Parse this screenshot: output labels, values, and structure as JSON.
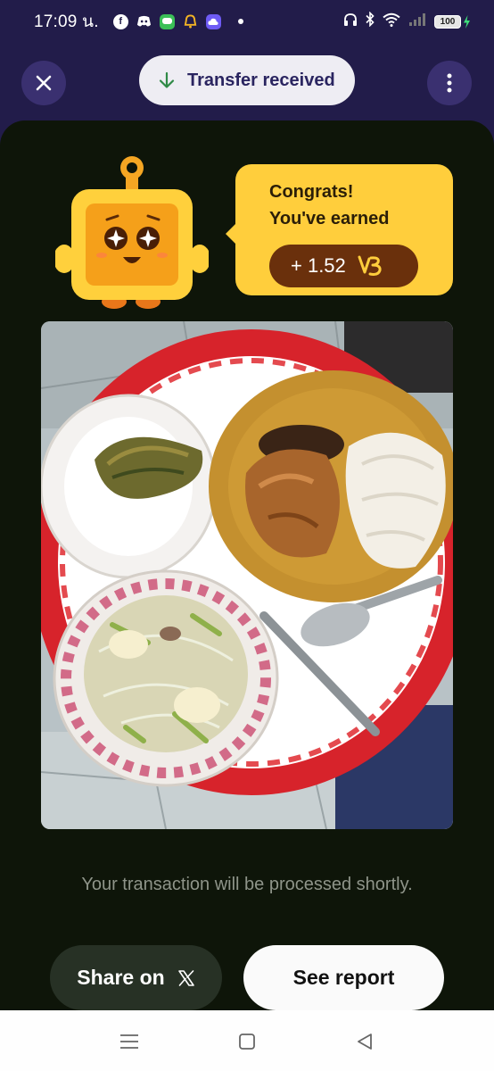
{
  "status_bar": {
    "time": "17:09 น.",
    "notification_icons": [
      "facebook-icon",
      "discord-icon",
      "line-icon",
      "alert-app-icon",
      "cloud-app-icon"
    ],
    "battery_level": "100"
  },
  "top_nav": {
    "transfer_label": "Transfer received"
  },
  "reward": {
    "congrats_line1": "Congrats!",
    "congrats_line2": "You've earned",
    "amount": "+ 1.52",
    "currency_icon": "b3-token-icon"
  },
  "photo": {
    "subject": "food-tray-photo"
  },
  "footer": {
    "note": "Your transaction will be processed shortly."
  },
  "actions": {
    "share_label": "Share on",
    "share_icon": "x-logo-icon",
    "report_label": "See report"
  },
  "colors": {
    "header_bg": "#221c4a",
    "card_bg": "#0e1509",
    "bubble_yellow": "#ffce3c",
    "earn_pill": "#6a300c",
    "pill_text": "#2a2560",
    "transfer_arrow": "#2f8a46"
  }
}
